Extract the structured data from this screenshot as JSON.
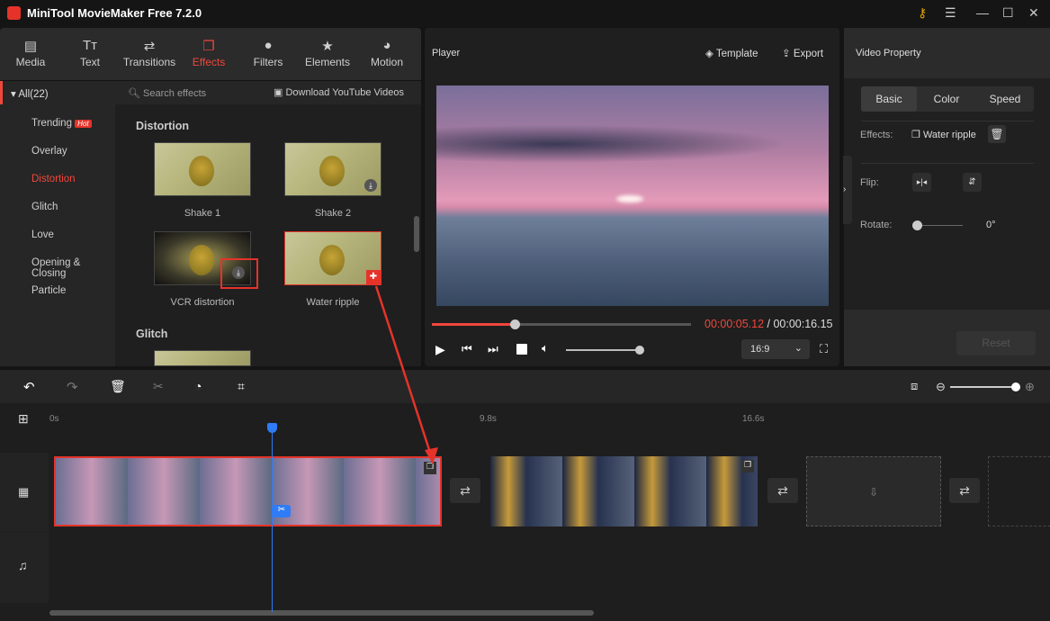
{
  "app": {
    "title": "MiniTool MovieMaker Free 7.2.0"
  },
  "toolbar": {
    "tabs": [
      {
        "label": "Media",
        "icon": "folder-icon"
      },
      {
        "label": "Text",
        "icon": "text-icon"
      },
      {
        "label": "Transitions",
        "icon": "transitions-icon"
      },
      {
        "label": "Effects",
        "icon": "effects-icon",
        "active": true
      },
      {
        "label": "Filters",
        "icon": "filters-icon"
      },
      {
        "label": "Elements",
        "icon": "elements-icon"
      },
      {
        "label": "Motion",
        "icon": "motion-icon"
      }
    ]
  },
  "sidebar": {
    "all": "All(22)",
    "items": [
      "Trending",
      "Overlay",
      "Distortion",
      "Glitch",
      "Love",
      "Opening & Closing",
      "Particle"
    ],
    "hot_badge": "Hot",
    "active": "Distortion"
  },
  "effects": {
    "search_placeholder": "Search effects",
    "download_youtube": "Download YouTube Videos",
    "section1": "Distortion",
    "section2": "Glitch",
    "items": [
      "Shake 1",
      "Shake 2",
      "VCR distortion",
      "Water ripple"
    ]
  },
  "player": {
    "title": "Player",
    "template": "Template",
    "export": "Export",
    "current_time": "00:00:05.12",
    "separator": " / ",
    "total_time": "00:00:16.15",
    "aspect": "16:9",
    "progress": 0.32,
    "volume": 0.95
  },
  "property": {
    "title": "Video Property",
    "tabs": [
      "Basic",
      "Color",
      "Speed"
    ],
    "active_tab": "Basic",
    "effects_label": "Effects:",
    "effect_value": "Water ripple",
    "flip_label": "Flip:",
    "rotate_label": "Rotate:",
    "rotate_value": "0°",
    "reset": "Reset"
  },
  "timeline": {
    "ruler": [
      "0s",
      "9.8s",
      "16.6s"
    ],
    "playhead_time_fraction": 0.31
  },
  "colors": {
    "accent": "#f0473c",
    "playhead": "#2f7cf6"
  }
}
